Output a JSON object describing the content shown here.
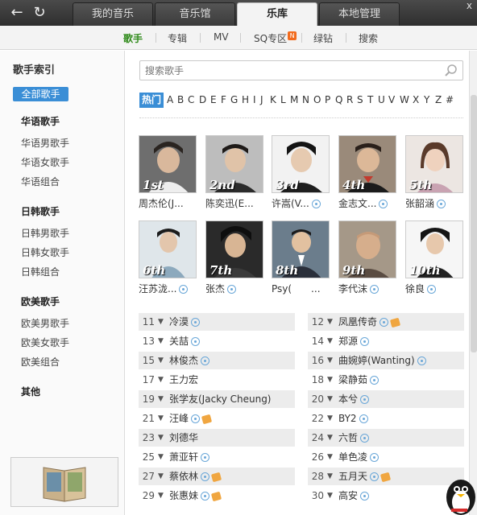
{
  "nav": {
    "back_icon": "back-arrow-icon",
    "refresh_icon": "refresh-icon",
    "close": "x"
  },
  "tabs": [
    {
      "label": "我的音乐"
    },
    {
      "label": "音乐馆"
    },
    {
      "label": "乐库",
      "active": true
    },
    {
      "label": "本地管理"
    }
  ],
  "subnav": [
    {
      "label": "歌手",
      "active": true
    },
    {
      "label": "专辑"
    },
    {
      "label": "MV"
    },
    {
      "label": "SQ专区",
      "badge": "N"
    },
    {
      "label": "绿钻"
    },
    {
      "label": "搜索"
    }
  ],
  "sidebar": {
    "title": "歌手索引",
    "all_label": "全部歌手",
    "groups": [
      {
        "title": "华语歌手",
        "items": [
          "华语男歌手",
          "华语女歌手",
          "华语组合"
        ]
      },
      {
        "title": "日韩歌手",
        "items": [
          "日韩男歌手",
          "日韩女歌手",
          "日韩组合"
        ]
      },
      {
        "title": "欧美歌手",
        "items": [
          "欧美男歌手",
          "欧美女歌手",
          "欧美组合"
        ]
      },
      {
        "title": "其他",
        "items": []
      }
    ]
  },
  "search": {
    "placeholder": "搜索歌手",
    "icon": "search-icon"
  },
  "index": {
    "hot": "热门",
    "letters": [
      "A",
      "B",
      "C",
      "D",
      "E",
      "F",
      "G",
      "H",
      "I",
      "J",
      "K",
      "L",
      "M",
      "N",
      "O",
      "P",
      "Q",
      "R",
      "S",
      "T",
      "U",
      "V",
      "W",
      "X",
      "Y",
      "Z",
      "#"
    ]
  },
  "top_artists": [
    {
      "rank": "1st",
      "name": "周杰伦(J..."
    },
    {
      "rank": "2nd",
      "name": "陈奕迅(E..."
    },
    {
      "rank": "3rd",
      "name": "许嵩(V..."
    },
    {
      "rank": "4th",
      "name": "金志文..."
    },
    {
      "rank": "5th",
      "name": "张韶涵"
    },
    {
      "rank": "6th",
      "name": "汪苏泷..."
    },
    {
      "rank": "7th",
      "name": "张杰"
    },
    {
      "rank": "8th",
      "name": "Psy(　　..."
    },
    {
      "rank": "9th",
      "name": "李代沫"
    },
    {
      "rank": "10th",
      "name": "徐良"
    }
  ],
  "list_left": [
    {
      "num": "11",
      "name": "冷漠",
      "heart": false
    },
    {
      "num": "13",
      "name": "关喆",
      "heart": false
    },
    {
      "num": "15",
      "name": "林俊杰",
      "heart": false
    },
    {
      "num": "17",
      "name": "王力宏",
      "heart": false,
      "nobubble": true
    },
    {
      "num": "19",
      "name": "张学友(Jacky Cheung)",
      "heart": false,
      "nobubble": true
    },
    {
      "num": "21",
      "name": "汪峰",
      "heart": true
    },
    {
      "num": "23",
      "name": "刘德华",
      "heart": false,
      "nobubble": true
    },
    {
      "num": "25",
      "name": "萧亚轩",
      "heart": false
    },
    {
      "num": "27",
      "name": "蔡依林",
      "heart": true
    },
    {
      "num": "29",
      "name": "张惠妹",
      "heart": true
    }
  ],
  "list_right": [
    {
      "num": "12",
      "name": "凤凰传奇",
      "heart": true
    },
    {
      "num": "14",
      "name": "郑源",
      "heart": false
    },
    {
      "num": "16",
      "name": "曲婉婷(Wanting)",
      "heart": false
    },
    {
      "num": "18",
      "name": "梁静茹",
      "heart": false
    },
    {
      "num": "20",
      "name": "本兮",
      "heart": false
    },
    {
      "num": "22",
      "name": "BY2",
      "heart": false
    },
    {
      "num": "24",
      "name": "六哲",
      "heart": false
    },
    {
      "num": "26",
      "name": "单色凌",
      "heart": false
    },
    {
      "num": "28",
      "name": "五月天",
      "heart": true
    },
    {
      "num": "30",
      "name": "高安",
      "heart": false
    }
  ],
  "colors": {
    "accent": "#3a8ed6",
    "active_green": "#2f8a1a",
    "badge": "#f26b1d"
  }
}
